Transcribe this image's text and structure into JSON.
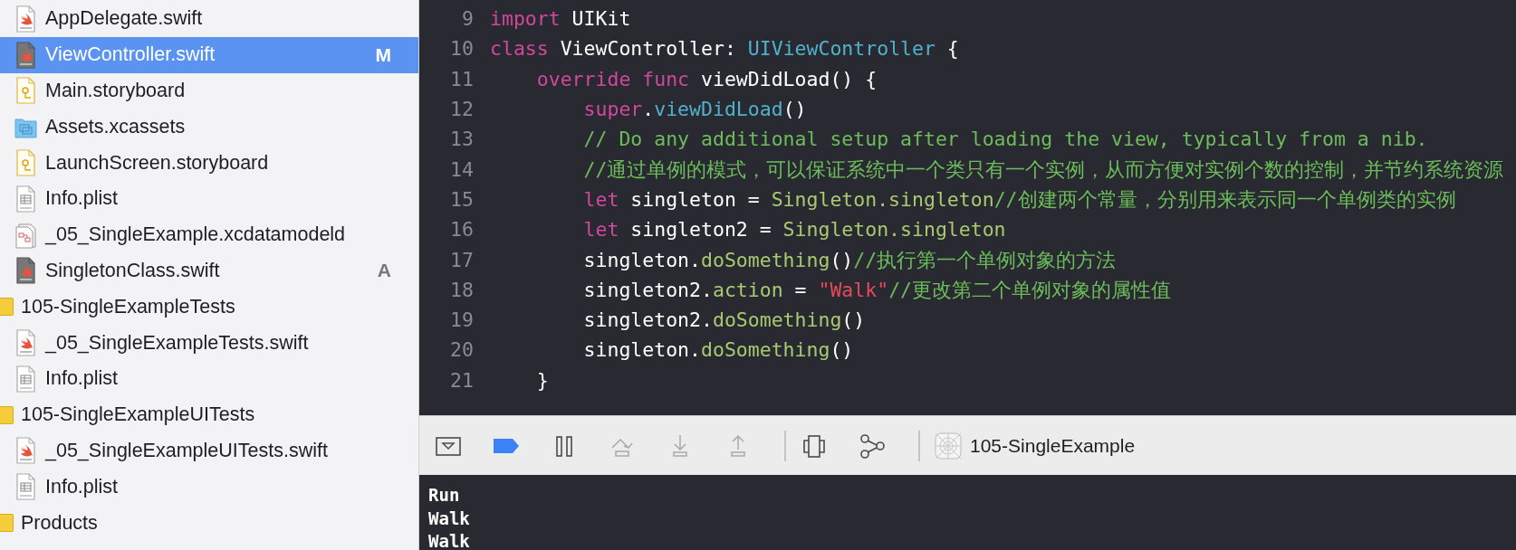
{
  "sidebar": {
    "items": [
      {
        "name": "AppDelegate.swift",
        "kind": "swift",
        "selected": false
      },
      {
        "name": "ViewController.swift",
        "kind": "swift-dark",
        "selected": true,
        "status": "M"
      },
      {
        "name": "Main.storyboard",
        "kind": "storyboard",
        "selected": false
      },
      {
        "name": "Assets.xcassets",
        "kind": "assets",
        "selected": false
      },
      {
        "name": "LaunchScreen.storyboard",
        "kind": "storyboard",
        "selected": false
      },
      {
        "name": "Info.plist",
        "kind": "plist",
        "selected": false
      },
      {
        "name": "_05_SingleExample.xcdatamodeld",
        "kind": "datamodel",
        "selected": false
      },
      {
        "name": "SingletonClass.swift",
        "kind": "swift-dark",
        "selected": false,
        "status": "A"
      }
    ],
    "groups": [
      {
        "name": "105-SingleExampleTests",
        "selected": false,
        "children": [
          {
            "name": "_05_SingleExampleTests.swift",
            "kind": "swift",
            "selected": false
          },
          {
            "name": "Info.plist",
            "kind": "plist",
            "selected": false
          }
        ]
      },
      {
        "name": "105-SingleExampleUITests",
        "selected": false,
        "children": [
          {
            "name": "_05_SingleExampleUITests.swift",
            "kind": "swift",
            "selected": false
          },
          {
            "name": "Info.plist",
            "kind": "plist",
            "selected": false
          }
        ]
      },
      {
        "name": "Products",
        "selected": false
      }
    ]
  },
  "editor": {
    "lines": [
      {
        "number": "9",
        "tokens": [
          {
            "kind": "keyword",
            "text": "import"
          },
          {
            "kind": "plain",
            "text": " UIKit"
          }
        ]
      },
      {
        "number": "10",
        "tokens": [
          {
            "kind": "keyword",
            "text": "class"
          },
          {
            "kind": "plain",
            "text": " ViewController: "
          },
          {
            "kind": "type",
            "text": "UIViewController"
          },
          {
            "kind": "plain",
            "text": " {"
          }
        ]
      },
      {
        "number": "11",
        "tokens": [
          {
            "kind": "keyword",
            "text": "    override func"
          },
          {
            "kind": "plain",
            "text": " viewDidLoad() {"
          }
        ]
      },
      {
        "number": "12",
        "tokens": [
          {
            "kind": "keyword",
            "text": "        super"
          },
          {
            "kind": "plain",
            "text": "."
          },
          {
            "kind": "type",
            "text": "viewDidLoad"
          },
          {
            "kind": "plain",
            "text": "()"
          }
        ]
      },
      {
        "number": "13",
        "tokens": [
          {
            "kind": "comment",
            "text": "        // Do any additional setup after loading the view, typically from a nib."
          }
        ]
      },
      {
        "number": "14",
        "tokens": [
          {
            "kind": "comment",
            "text": "        //通过单例的模式，可以保证系统中一个类只有一个实例，从而方便对实例个数的控制，并节约系统资源"
          }
        ]
      },
      {
        "number": "15",
        "tokens": [
          {
            "kind": "keyword",
            "text": "        let"
          },
          {
            "kind": "plain",
            "text": " singleton = "
          },
          {
            "kind": "project",
            "text": "Singleton.singleton"
          },
          {
            "kind": "comment",
            "text": "//创建两个常量，分别用来表示同一个单例类的实例"
          }
        ]
      },
      {
        "number": "16",
        "tokens": [
          {
            "kind": "keyword",
            "text": "        let"
          },
          {
            "kind": "plain",
            "text": " singleton2 = "
          },
          {
            "kind": "project",
            "text": "Singleton.singleton"
          }
        ]
      },
      {
        "number": "17",
        "tokens": [
          {
            "kind": "plain",
            "text": "        singleton."
          },
          {
            "kind": "project",
            "text": "doSomething"
          },
          {
            "kind": "plain",
            "text": "()"
          },
          {
            "kind": "comment",
            "text": "//执行第一个单例对象的方法"
          }
        ]
      },
      {
        "number": "18",
        "tokens": [
          {
            "kind": "plain",
            "text": "        singleton2."
          },
          {
            "kind": "project",
            "text": "action"
          },
          {
            "kind": "plain",
            "text": " = "
          },
          {
            "kind": "string",
            "text": "\"Walk\""
          },
          {
            "kind": "comment",
            "text": "//更改第二个单例对象的属性值"
          }
        ]
      },
      {
        "number": "19",
        "tokens": [
          {
            "kind": "plain",
            "text": "        singleton2."
          },
          {
            "kind": "project",
            "text": "doSomething"
          },
          {
            "kind": "plain",
            "text": "()"
          }
        ]
      },
      {
        "number": "20",
        "tokens": [
          {
            "kind": "plain",
            "text": "        singleton."
          },
          {
            "kind": "project",
            "text": "doSomething"
          },
          {
            "kind": "plain",
            "text": "()"
          }
        ]
      },
      {
        "number": "21",
        "tokens": [
          {
            "kind": "plain",
            "text": "    }"
          }
        ]
      }
    ]
  },
  "debug_bar": {
    "buttons": [
      {
        "kind": "console-toggle",
        "disabled": false
      },
      {
        "kind": "breakpoints",
        "disabled": false,
        "on": true
      },
      {
        "kind": "pause",
        "disabled": false
      },
      {
        "kind": "step-over",
        "disabled": true
      },
      {
        "kind": "step-into",
        "disabled": true
      },
      {
        "kind": "step-out",
        "disabled": true
      },
      {
        "kind": "divider"
      },
      {
        "kind": "view-debugger",
        "disabled": false
      },
      {
        "kind": "memory-graph",
        "disabled": false
      },
      {
        "kind": "divider"
      }
    ],
    "scheme": {
      "name": "105-SingleExample"
    }
  },
  "console": {
    "lines": [
      "Run",
      "Walk",
      "Walk"
    ]
  }
}
